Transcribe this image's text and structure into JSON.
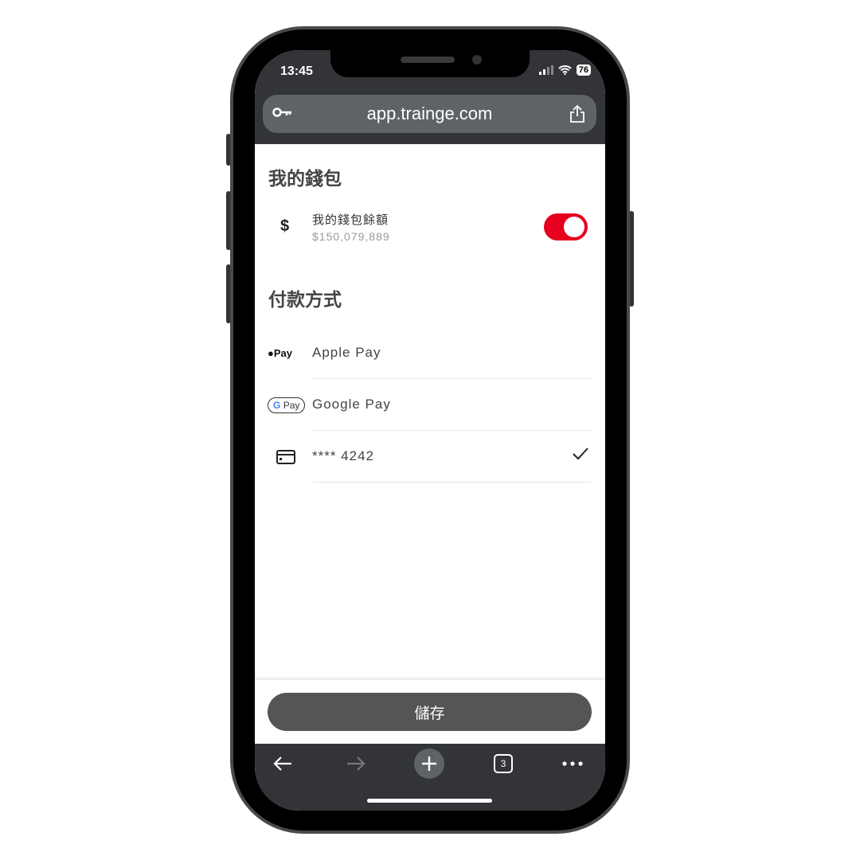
{
  "status_bar": {
    "time": "13:45",
    "battery": "76"
  },
  "browser": {
    "url": "app.trainge.com",
    "tab_count": "3"
  },
  "wallet": {
    "title": "我的錢包",
    "balance_label": "我的錢包餘額",
    "balance_value": "$150,079,889",
    "toggle_on": true,
    "toggle_color": "#e6001e"
  },
  "payment": {
    "title": "付款方式",
    "methods": [
      {
        "label": "Apple Pay",
        "icon": "apple-pay-icon",
        "badge": "Pay"
      },
      {
        "label": "Google Pay",
        "icon": "google-pay-icon",
        "badge": "Pay"
      },
      {
        "label": "**** 4242",
        "icon": "credit-card-icon",
        "selected": true
      }
    ]
  },
  "footer": {
    "save_label": "儲存"
  }
}
